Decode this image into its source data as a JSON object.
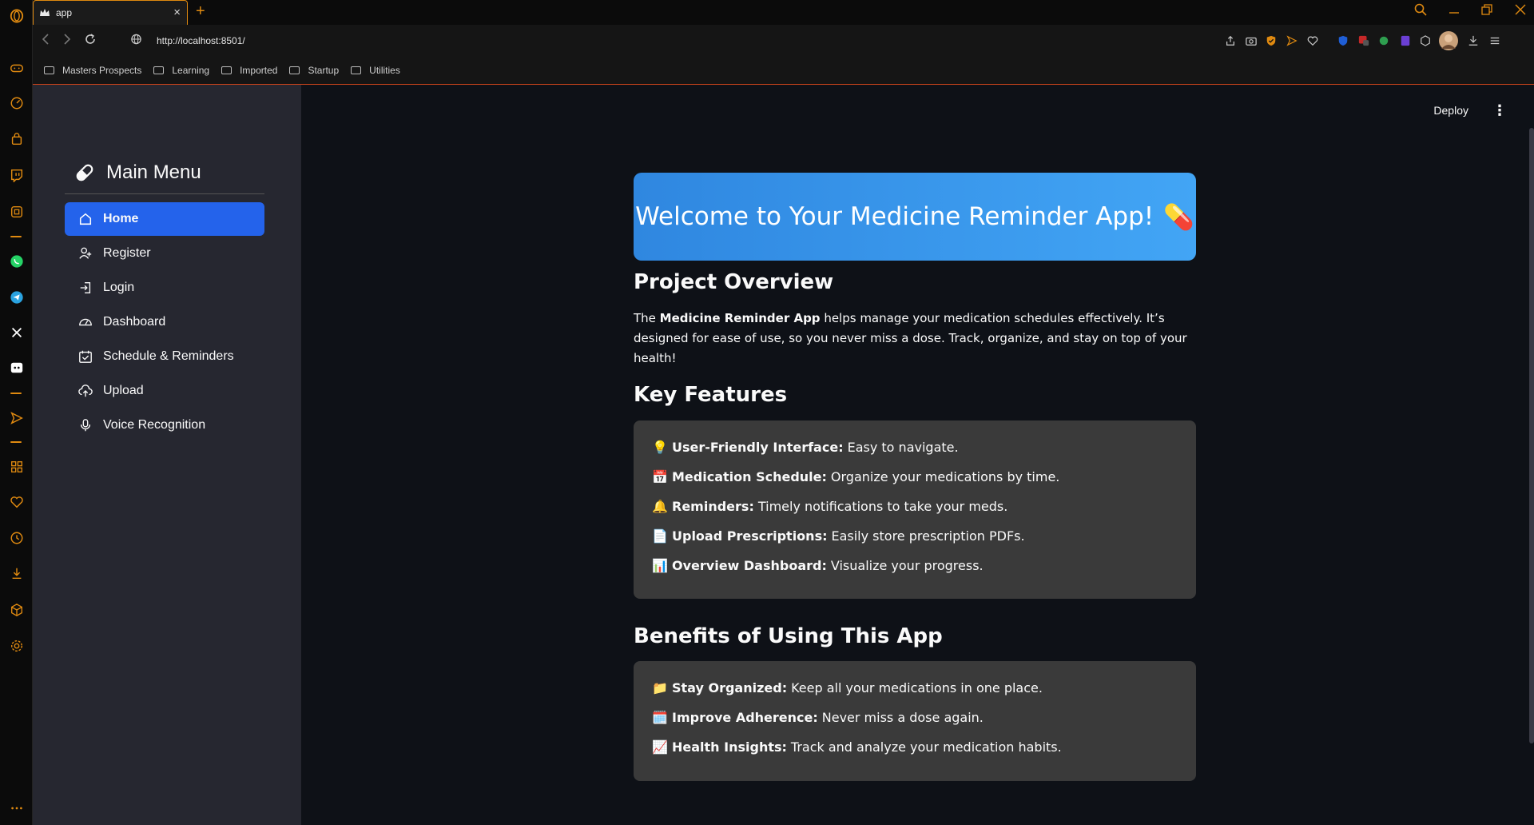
{
  "browser": {
    "tab_title": "app",
    "new_tab": "+",
    "close_tab": "×",
    "url": "http://localhost:8501/",
    "bookmarks": [
      "Masters Prospects",
      "Learning",
      "Imported",
      "Startup",
      "Utilities"
    ],
    "accent": "#e08a10"
  },
  "app": {
    "deploy_label": "Deploy",
    "menu_dots": "⋮",
    "sidebar": {
      "title": "Main Menu",
      "items": [
        {
          "label": "Home",
          "icon": "house-icon",
          "active": true
        },
        {
          "label": "Register",
          "icon": "person-add-icon",
          "active": false
        },
        {
          "label": "Login",
          "icon": "box-arrow-in-right-icon",
          "active": false
        },
        {
          "label": "Dashboard",
          "icon": "speedometer-icon",
          "active": false
        },
        {
          "label": "Schedule & Reminders",
          "icon": "calendar-check-icon",
          "active": false
        },
        {
          "label": "Upload",
          "icon": "cloud-upload-icon",
          "active": false
        },
        {
          "label": "Voice Recognition",
          "icon": "mic-icon",
          "active": false
        }
      ],
      "active_color": "#2463eb"
    },
    "hero_title": "Welcome to Your Medicine Reminder App!",
    "hero_emoji": "💊",
    "overview": {
      "heading": "Project Overview",
      "text_prefix": "The ",
      "text_bold": "Medicine Reminder App",
      "text_rest": " helps manage your medication schedules effectively. It’s designed for ease of use, so you never miss a dose. Track, organize, and stay on top of your health!"
    },
    "features": {
      "heading": "Key Features",
      "items": [
        {
          "emoji": "💡",
          "bold": "User-Friendly Interface:",
          "text": "Easy to navigate."
        },
        {
          "emoji": "📅",
          "bold": "Medication Schedule:",
          "text": "Organize your medications by time."
        },
        {
          "emoji": "🔔",
          "bold": "Reminders:",
          "text": "Timely notifications to take your meds."
        },
        {
          "emoji": "📄",
          "bold": "Upload Prescriptions:",
          "text": "Easily store prescription PDFs."
        },
        {
          "emoji": "📊",
          "bold": "Overview Dashboard:",
          "text": "Visualize your progress."
        }
      ]
    },
    "benefits": {
      "heading": "Benefits of Using This App",
      "items": [
        {
          "emoji": "📁",
          "bold": "Stay Organized:",
          "text": "Keep all your medications in one place."
        },
        {
          "emoji": "🗓️",
          "bold": "Improve Adherence:",
          "text": "Never miss a dose again."
        },
        {
          "emoji": "📈",
          "bold": "Health Insights:",
          "text": "Track and analyze your medication habits."
        }
      ]
    }
  }
}
